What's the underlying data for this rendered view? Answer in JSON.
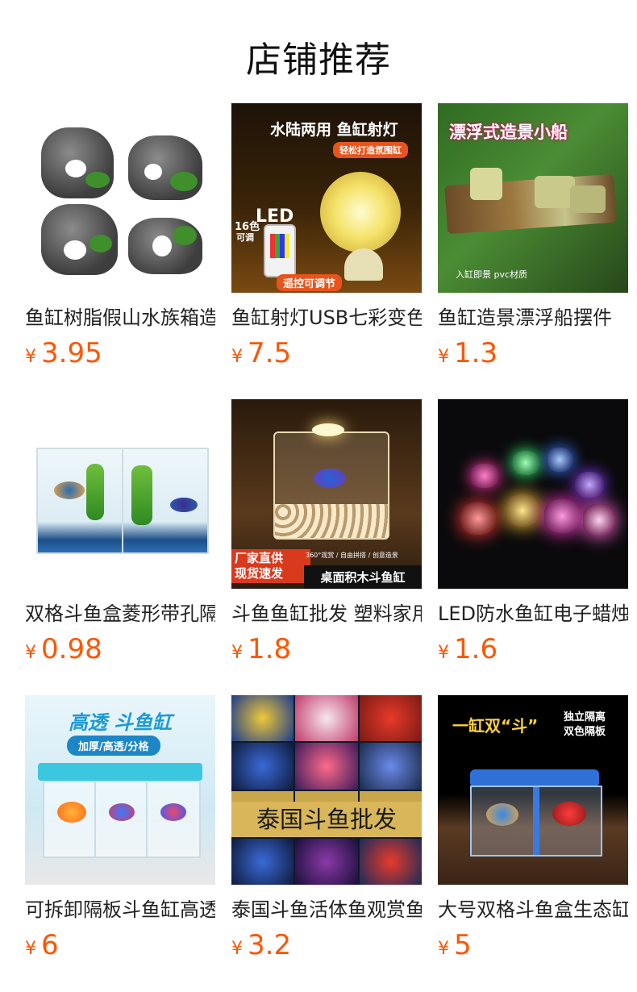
{
  "header": {
    "title": "店铺推荐"
  },
  "currency_symbol": "¥",
  "products": [
    {
      "name": "鱼缸树脂假山水族箱造景",
      "price": "3.95",
      "image_text": []
    },
    {
      "name": "鱼缸射灯USB七彩变色",
      "price": "7.5",
      "image_text": [
        "水陆两用 鱼缸射灯",
        "轻松打造氛围缸",
        "LED",
        "16色",
        "可调",
        "遥控可调节"
      ]
    },
    {
      "name": "鱼缸造景漂浮船摆件",
      "price": "1.3",
      "image_text": [
        "漂浮式造景小船",
        "入缸即景 pvc材质"
      ]
    },
    {
      "name": "双格斗鱼盒菱形带孔隔离",
      "price": "0.98",
      "image_text": []
    },
    {
      "name": "斗鱼鱼缸批发 塑料家用",
      "price": "1.8",
      "image_text": [
        "厂家直供",
        "现货速发",
        "360°观赏 / 自由拼搭 / 创意造景",
        "桌面积木斗鱼缸"
      ]
    },
    {
      "name": "LED防水鱼缸电子蜡烛灯",
      "price": "1.6",
      "image_text": []
    },
    {
      "name": "可拆卸隔板斗鱼缸高透",
      "price": "6",
      "image_text": [
        "高透 斗鱼缸",
        "加厚/高透/分格"
      ]
    },
    {
      "name": "泰国斗鱼活体鱼观赏鱼",
      "price": "3.2",
      "image_text": [
        "泰国斗鱼批发"
      ]
    },
    {
      "name": "大号双格斗鱼盒生态缸",
      "price": "5",
      "image_text": [
        "一缸双“斗”",
        "独立隔离",
        "双色隔板"
      ]
    }
  ]
}
